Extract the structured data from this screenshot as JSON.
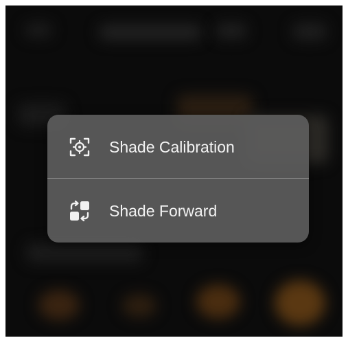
{
  "menu": {
    "items": [
      {
        "label": "Shade Calibration",
        "icon": "focus-target-icon"
      },
      {
        "label": "Shade Forward",
        "icon": "swap-forward-icon"
      }
    ]
  },
  "colors": {
    "menu_background": "#5c5c5c",
    "text": "#f2f2f2",
    "backdrop": "#0b0b0b"
  }
}
